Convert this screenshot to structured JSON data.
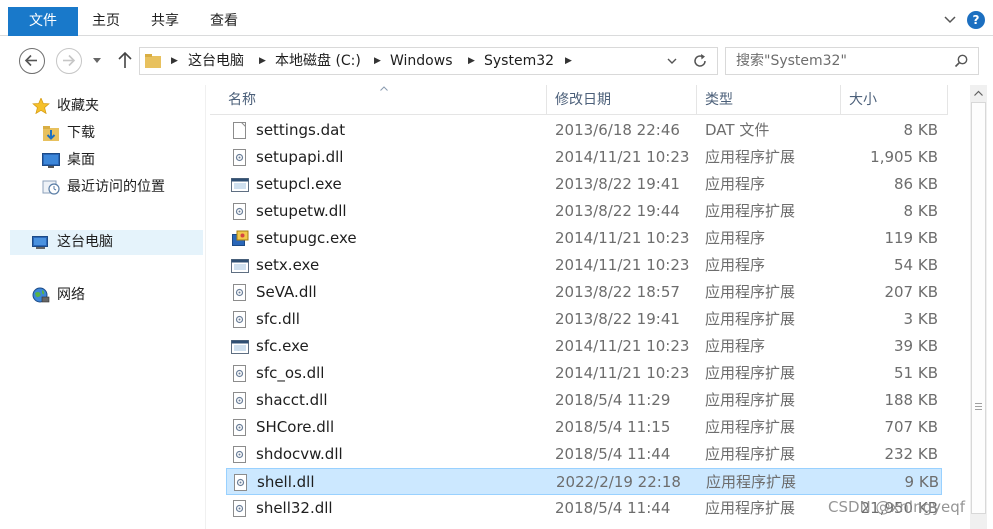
{
  "ribbon": {
    "file_tab": "文件",
    "tabs": [
      "主页",
      "共享",
      "查看"
    ],
    "help_label": "?"
  },
  "nav": {
    "address": {
      "crumbs": [
        "这台电脑",
        "本地磁盘 (C:)",
        "Windows",
        "System32"
      ]
    },
    "search": {
      "placeholder": "搜索\"System32\""
    }
  },
  "sidebar": {
    "favorites": "收藏夹",
    "favorite_items": [
      "下载",
      "桌面",
      "最近访问的位置"
    ],
    "this_pc": "这台电脑",
    "network": "网络"
  },
  "columns": {
    "name": "名称",
    "date": "修改日期",
    "type": "类型",
    "size": "大小"
  },
  "files": [
    {
      "name": "settings.dat",
      "date": "2013/6/18 22:46",
      "type": "DAT 文件",
      "size": "8 KB",
      "icon": "blank-file-icon"
    },
    {
      "name": "setupapi.dll",
      "date": "2014/11/21 10:23",
      "type": "应用程序扩展",
      "size": "1,905 KB",
      "icon": "dll-file-icon"
    },
    {
      "name": "setupcl.exe",
      "date": "2013/8/22 19:41",
      "type": "应用程序",
      "size": "86 KB",
      "icon": "exe-file-icon"
    },
    {
      "name": "setupetw.dll",
      "date": "2013/8/22 19:44",
      "type": "应用程序扩展",
      "size": "8 KB",
      "icon": "dll-file-icon"
    },
    {
      "name": "setupugc.exe",
      "date": "2014/11/21 10:23",
      "type": "应用程序",
      "size": "119 KB",
      "icon": "installer-icon"
    },
    {
      "name": "setx.exe",
      "date": "2014/11/21 10:23",
      "type": "应用程序",
      "size": "54 KB",
      "icon": "exe-file-icon"
    },
    {
      "name": "SeVA.dll",
      "date": "2013/8/22 18:57",
      "type": "应用程序扩展",
      "size": "207 KB",
      "icon": "dll-file-icon"
    },
    {
      "name": "sfc.dll",
      "date": "2013/8/22 19:41",
      "type": "应用程序扩展",
      "size": "3 KB",
      "icon": "dll-file-icon"
    },
    {
      "name": "sfc.exe",
      "date": "2014/11/21 10:23",
      "type": "应用程序",
      "size": "39 KB",
      "icon": "exe-file-icon"
    },
    {
      "name": "sfc_os.dll",
      "date": "2014/11/21 10:23",
      "type": "应用程序扩展",
      "size": "51 KB",
      "icon": "dll-file-icon"
    },
    {
      "name": "shacct.dll",
      "date": "2018/5/4 11:29",
      "type": "应用程序扩展",
      "size": "188 KB",
      "icon": "dll-file-icon"
    },
    {
      "name": "SHCore.dll",
      "date": "2018/5/4 11:15",
      "type": "应用程序扩展",
      "size": "707 KB",
      "icon": "dll-file-icon"
    },
    {
      "name": "shdocvw.dll",
      "date": "2018/5/4 11:44",
      "type": "应用程序扩展",
      "size": "232 KB",
      "icon": "dll-file-icon"
    },
    {
      "name": "shell.dll",
      "date": "2022/2/19 22:18",
      "type": "应用程序扩展",
      "size": "9 KB",
      "icon": "dll-file-icon",
      "selected": true
    },
    {
      "name": "shell32.dll",
      "date": "2018/5/4 11:44",
      "type": "应用程序扩展",
      "size": "21,950 KB",
      "icon": "dll-file-icon"
    }
  ],
  "watermark": "CSDN @xnlngyeqf"
}
